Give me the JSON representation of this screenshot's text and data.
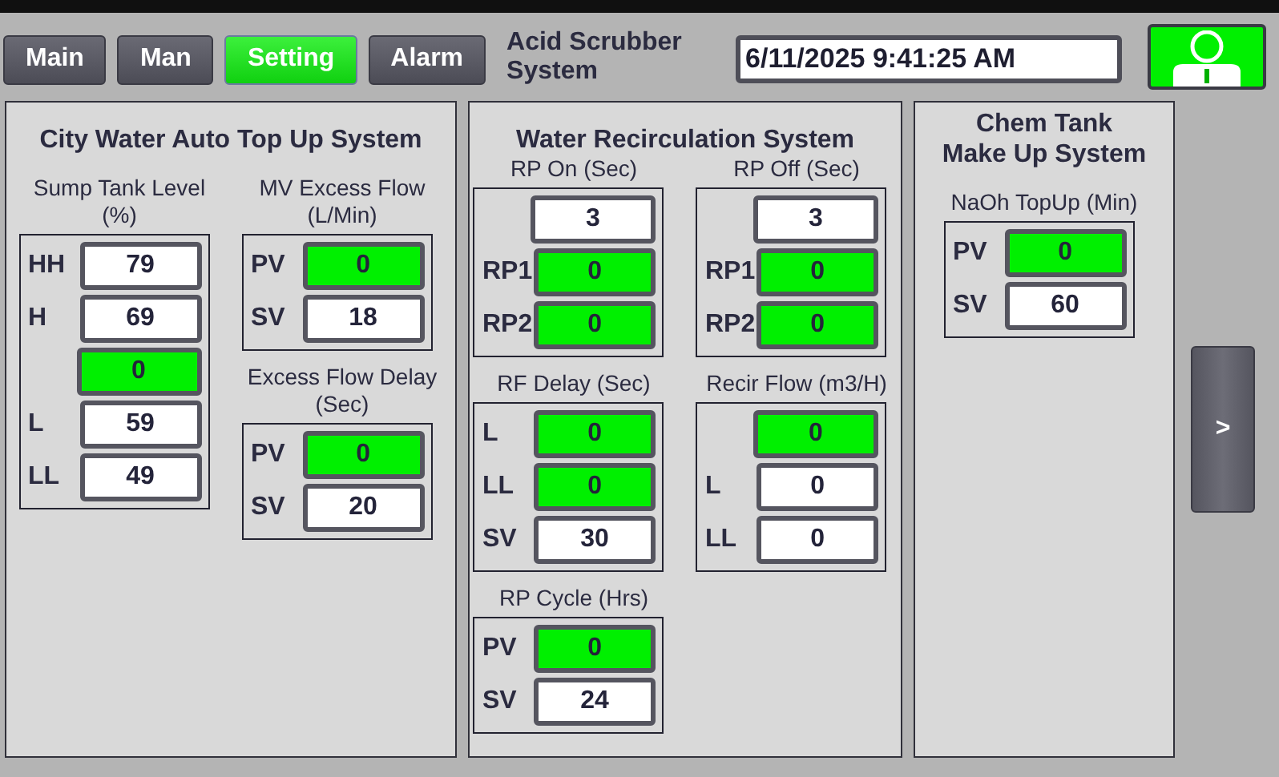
{
  "nav": [
    {
      "label": "Main",
      "selected": false
    },
    {
      "label": "Man",
      "selected": false
    },
    {
      "label": "Setting",
      "selected": true
    },
    {
      "label": "Alarm",
      "selected": false
    }
  ],
  "header": {
    "title": "Acid Scrubber\nSystem",
    "datetime": "6/11/2025 9:41:25 AM"
  },
  "panels": [
    {
      "title": "City Water Auto Top Up System",
      "columns": [
        [
          {
            "title": "Sump Tank Level\n(%)",
            "rows": [
              {
                "label": "HH",
                "value": "79",
                "kind": "input"
              },
              {
                "label": "H",
                "value": "69",
                "kind": "input"
              },
              {
                "value": "0",
                "kind": "display"
              },
              {
                "label": "L",
                "value": "59",
                "kind": "input"
              },
              {
                "label": "LL",
                "value": "49",
                "kind": "input"
              }
            ]
          }
        ],
        [
          {
            "title": "MV Excess Flow\n(L/Min)",
            "rows": [
              {
                "label": "PV",
                "value": "0",
                "kind": "display"
              },
              {
                "label": "SV",
                "value": "18",
                "kind": "input"
              }
            ]
          },
          {
            "title": "Excess Flow Delay\n(Sec)",
            "rows": [
              {
                "label": "PV",
                "value": "0",
                "kind": "display"
              },
              {
                "label": "SV",
                "value": "20",
                "kind": "input"
              }
            ]
          }
        ]
      ]
    },
    {
      "title": "Water Recirculation System",
      "columns": [
        [
          {
            "title": "RP On (Sec)",
            "rows": [
              {
                "value": "3",
                "kind": "input"
              },
              {
                "label": "RP1",
                "value": "0",
                "kind": "display"
              },
              {
                "label": "RP2",
                "value": "0",
                "kind": "display"
              }
            ]
          },
          {
            "title": "RF Delay (Sec)",
            "rows": [
              {
                "label": "L",
                "value": "0",
                "kind": "display"
              },
              {
                "label": "LL",
                "value": "0",
                "kind": "display"
              },
              {
                "label": "SV",
                "value": "30",
                "kind": "input"
              }
            ]
          },
          {
            "title": "RP Cycle (Hrs)",
            "rows": [
              {
                "label": "PV",
                "value": "0",
                "kind": "display"
              },
              {
                "label": "SV",
                "value": "24",
                "kind": "input"
              }
            ]
          }
        ],
        [
          {
            "title": "RP Off (Sec)",
            "rows": [
              {
                "value": "3",
                "kind": "input"
              },
              {
                "label": "RP1",
                "value": "0",
                "kind": "display"
              },
              {
                "label": "RP2",
                "value": "0",
                "kind": "display"
              }
            ]
          },
          {
            "title": "Recir Flow (m3/H)",
            "rows": [
              {
                "value": "0",
                "kind": "display"
              },
              {
                "label": "L",
                "value": "0",
                "kind": "input"
              },
              {
                "label": "LL",
                "value": "0",
                "kind": "input"
              }
            ]
          }
        ]
      ]
    },
    {
      "title": "Chem Tank\nMake Up System",
      "columns": [
        [
          {
            "title": "NaOh TopUp (Min)",
            "rows": [
              {
                "label": "PV",
                "value": "0",
                "kind": "display"
              },
              {
                "label": "SV",
                "value": "60",
                "kind": "input"
              }
            ]
          }
        ]
      ]
    }
  ],
  "next_button": {
    "label": ">"
  }
}
